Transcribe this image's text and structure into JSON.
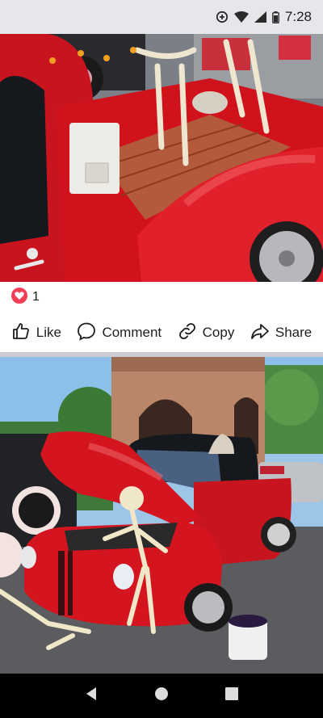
{
  "status_bar": {
    "time": "7:28"
  },
  "post": {
    "reaction_count": "1",
    "actions": [
      {
        "label": "Like",
        "icon": "thumbs-up-icon"
      },
      {
        "label": "Comment",
        "icon": "comment-icon"
      },
      {
        "label": "Copy",
        "icon": "link-icon"
      },
      {
        "label": "Share",
        "icon": "share-arrow-icon"
      }
    ]
  },
  "colors": {
    "reaction_heart": "#f33e58",
    "nav_bar": "#000000",
    "status_bar": "#e6e7ea"
  }
}
